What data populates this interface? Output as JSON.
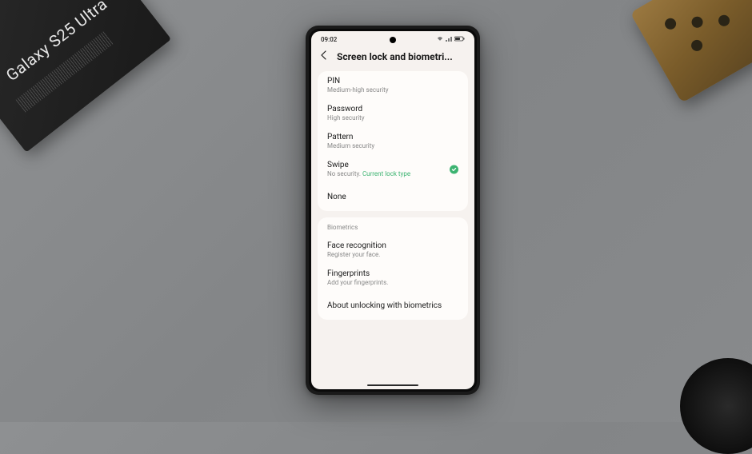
{
  "environment": {
    "box_label": "Galaxy S25 Ultra"
  },
  "statusbar": {
    "time": "09:02"
  },
  "header": {
    "title": "Screen lock and biometri..."
  },
  "lock_options": {
    "pin": {
      "title": "PIN",
      "sub": "Medium-high security"
    },
    "password": {
      "title": "Password",
      "sub": "High security"
    },
    "pattern": {
      "title": "Pattern",
      "sub": "Medium security"
    },
    "swipe": {
      "title": "Swipe",
      "sub_prefix": "No security.",
      "sub_active": "Current lock type",
      "selected": true
    },
    "none": {
      "title": "None"
    }
  },
  "biometrics": {
    "header": "Biometrics",
    "face": {
      "title": "Face recognition",
      "sub": "Register your face."
    },
    "fingerprints": {
      "title": "Fingerprints",
      "sub": "Add your fingerprints."
    },
    "about": {
      "title": "About unlocking with biometrics"
    }
  }
}
